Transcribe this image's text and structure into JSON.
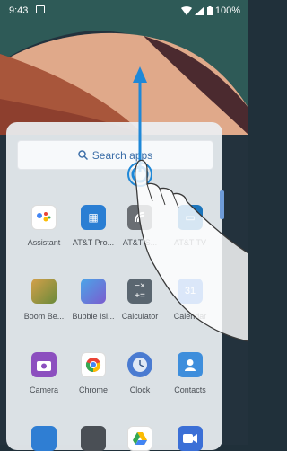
{
  "status_bar": {
    "time": "9:43",
    "battery": "100%"
  },
  "search": {
    "label": "Search apps"
  },
  "apps": [
    {
      "label": "Assistant",
      "icon": "google-assistant-icon",
      "color": "#ffffff"
    },
    {
      "label": "AT&T Pro...",
      "icon": "att-pro-tools-icon",
      "color": "#2a7ed3"
    },
    {
      "label": "AT&T S...",
      "icon": "att-signal-icon",
      "color": "#6a6e73"
    },
    {
      "label": "AT&T TV",
      "icon": "att-tv-icon",
      "color": "#1c75bc"
    },
    {
      "label": "Boom Be...",
      "icon": "boom-beach-icon",
      "color": "#6a8a3a"
    },
    {
      "label": "Bubble Isl...",
      "icon": "bubble-island-icon",
      "color": "#7b5ccf"
    },
    {
      "label": "Calculator",
      "icon": "calculator-icon",
      "color": "#5a6670"
    },
    {
      "label": "Calendar",
      "icon": "calendar-icon",
      "color": "#3b7ddd"
    },
    {
      "label": "Camera",
      "icon": "camera-icon",
      "color": "#8c4fbf"
    },
    {
      "label": "Chrome",
      "icon": "chrome-icon",
      "color": "#ffffff"
    },
    {
      "label": "Clock",
      "icon": "clock-icon",
      "color": "#4a7bd1"
    },
    {
      "label": "Contacts",
      "icon": "contacts-icon",
      "color": "#3e8edc"
    },
    {
      "label": "",
      "icon": "app-icon",
      "color": "#2f7ed3"
    },
    {
      "label": "",
      "icon": "app-icon",
      "color": "#4a4f55"
    },
    {
      "label": "",
      "icon": "google-drive-icon",
      "color": "#ffffff"
    },
    {
      "label": "",
      "icon": "duo-icon",
      "color": "#3b6fd6"
    }
  ],
  "colors": {
    "accent": "#1e88d8",
    "search_text": "#3d6fa8"
  }
}
